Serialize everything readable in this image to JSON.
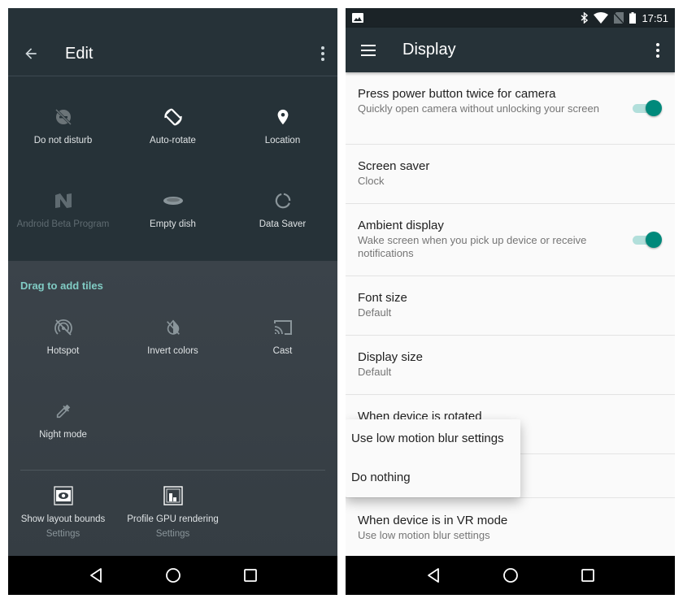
{
  "left_phone": {
    "toolbar": {
      "title": "Edit",
      "back_icon": "arrow-back-icon",
      "more_icon": "more-vert-icon"
    },
    "active_tiles": [
      {
        "label": "Do not disturb",
        "icon": "do-not-disturb-icon",
        "state": "off"
      },
      {
        "label": "Auto-rotate",
        "icon": "auto-rotate-icon",
        "state": "on"
      },
      {
        "label": "Location",
        "icon": "location-pin-icon",
        "state": "on"
      },
      {
        "label": "Android Beta Program",
        "icon": "android-n-icon",
        "state": "unavailable"
      },
      {
        "label": "Empty dish",
        "icon": "dish-icon",
        "state": "on"
      },
      {
        "label": "Data Saver",
        "icon": "data-saver-icon",
        "state": "off"
      }
    ],
    "add_section": {
      "title": "Drag to add tiles",
      "tiles": [
        {
          "label": "Hotspot",
          "icon": "hotspot-off-icon"
        },
        {
          "label": "Invert colors",
          "icon": "invert-colors-off-icon"
        },
        {
          "label": "Cast",
          "icon": "cast-icon"
        },
        {
          "label": "Night mode",
          "icon": "eyedropper-icon"
        }
      ],
      "third_party_tiles": [
        {
          "label": "Show layout bounds",
          "sublabel": "Settings",
          "icon": "layout-bounds-icon"
        },
        {
          "label": "Profile GPU rendering",
          "sublabel": "Settings",
          "icon": "gpu-profile-icon"
        }
      ]
    },
    "navbar": {
      "back": "nav-back-icon",
      "home": "nav-home-icon",
      "recents": "nav-recents-icon"
    }
  },
  "right_phone": {
    "status_bar": {
      "time": "17:51",
      "icons": [
        "image-notification-icon",
        "bluetooth-icon",
        "wifi-icon",
        "no-sim-icon",
        "battery-icon"
      ]
    },
    "toolbar": {
      "title": "Display",
      "menu_icon": "hamburger-menu-icon",
      "more_icon": "more-vert-icon"
    },
    "preferences": [
      {
        "title": "Press power button twice for camera",
        "summary": "Quickly open camera without unlocking your screen",
        "toggle": true
      },
      {
        "title": "Screen saver",
        "summary": "Clock"
      },
      {
        "title": "Ambient display",
        "summary": "Wake screen when you pick up device or receive notifications",
        "toggle": true
      },
      {
        "title": "Font size",
        "summary": "Default"
      },
      {
        "title": "Display size",
        "summary": "Default"
      },
      {
        "title": "When device is rotated",
        "summary": ""
      },
      {
        "title": "",
        "summary": ""
      },
      {
        "title": "When device is in VR mode",
        "summary": "Use low motion blur settings"
      }
    ],
    "popup_menu": {
      "options": [
        "Use low motion blur settings",
        "Do nothing"
      ]
    },
    "accent_color": "#00897b",
    "navbar": {
      "back": "nav-back-icon",
      "home": "nav-home-icon",
      "recents": "nav-recents-icon"
    }
  }
}
